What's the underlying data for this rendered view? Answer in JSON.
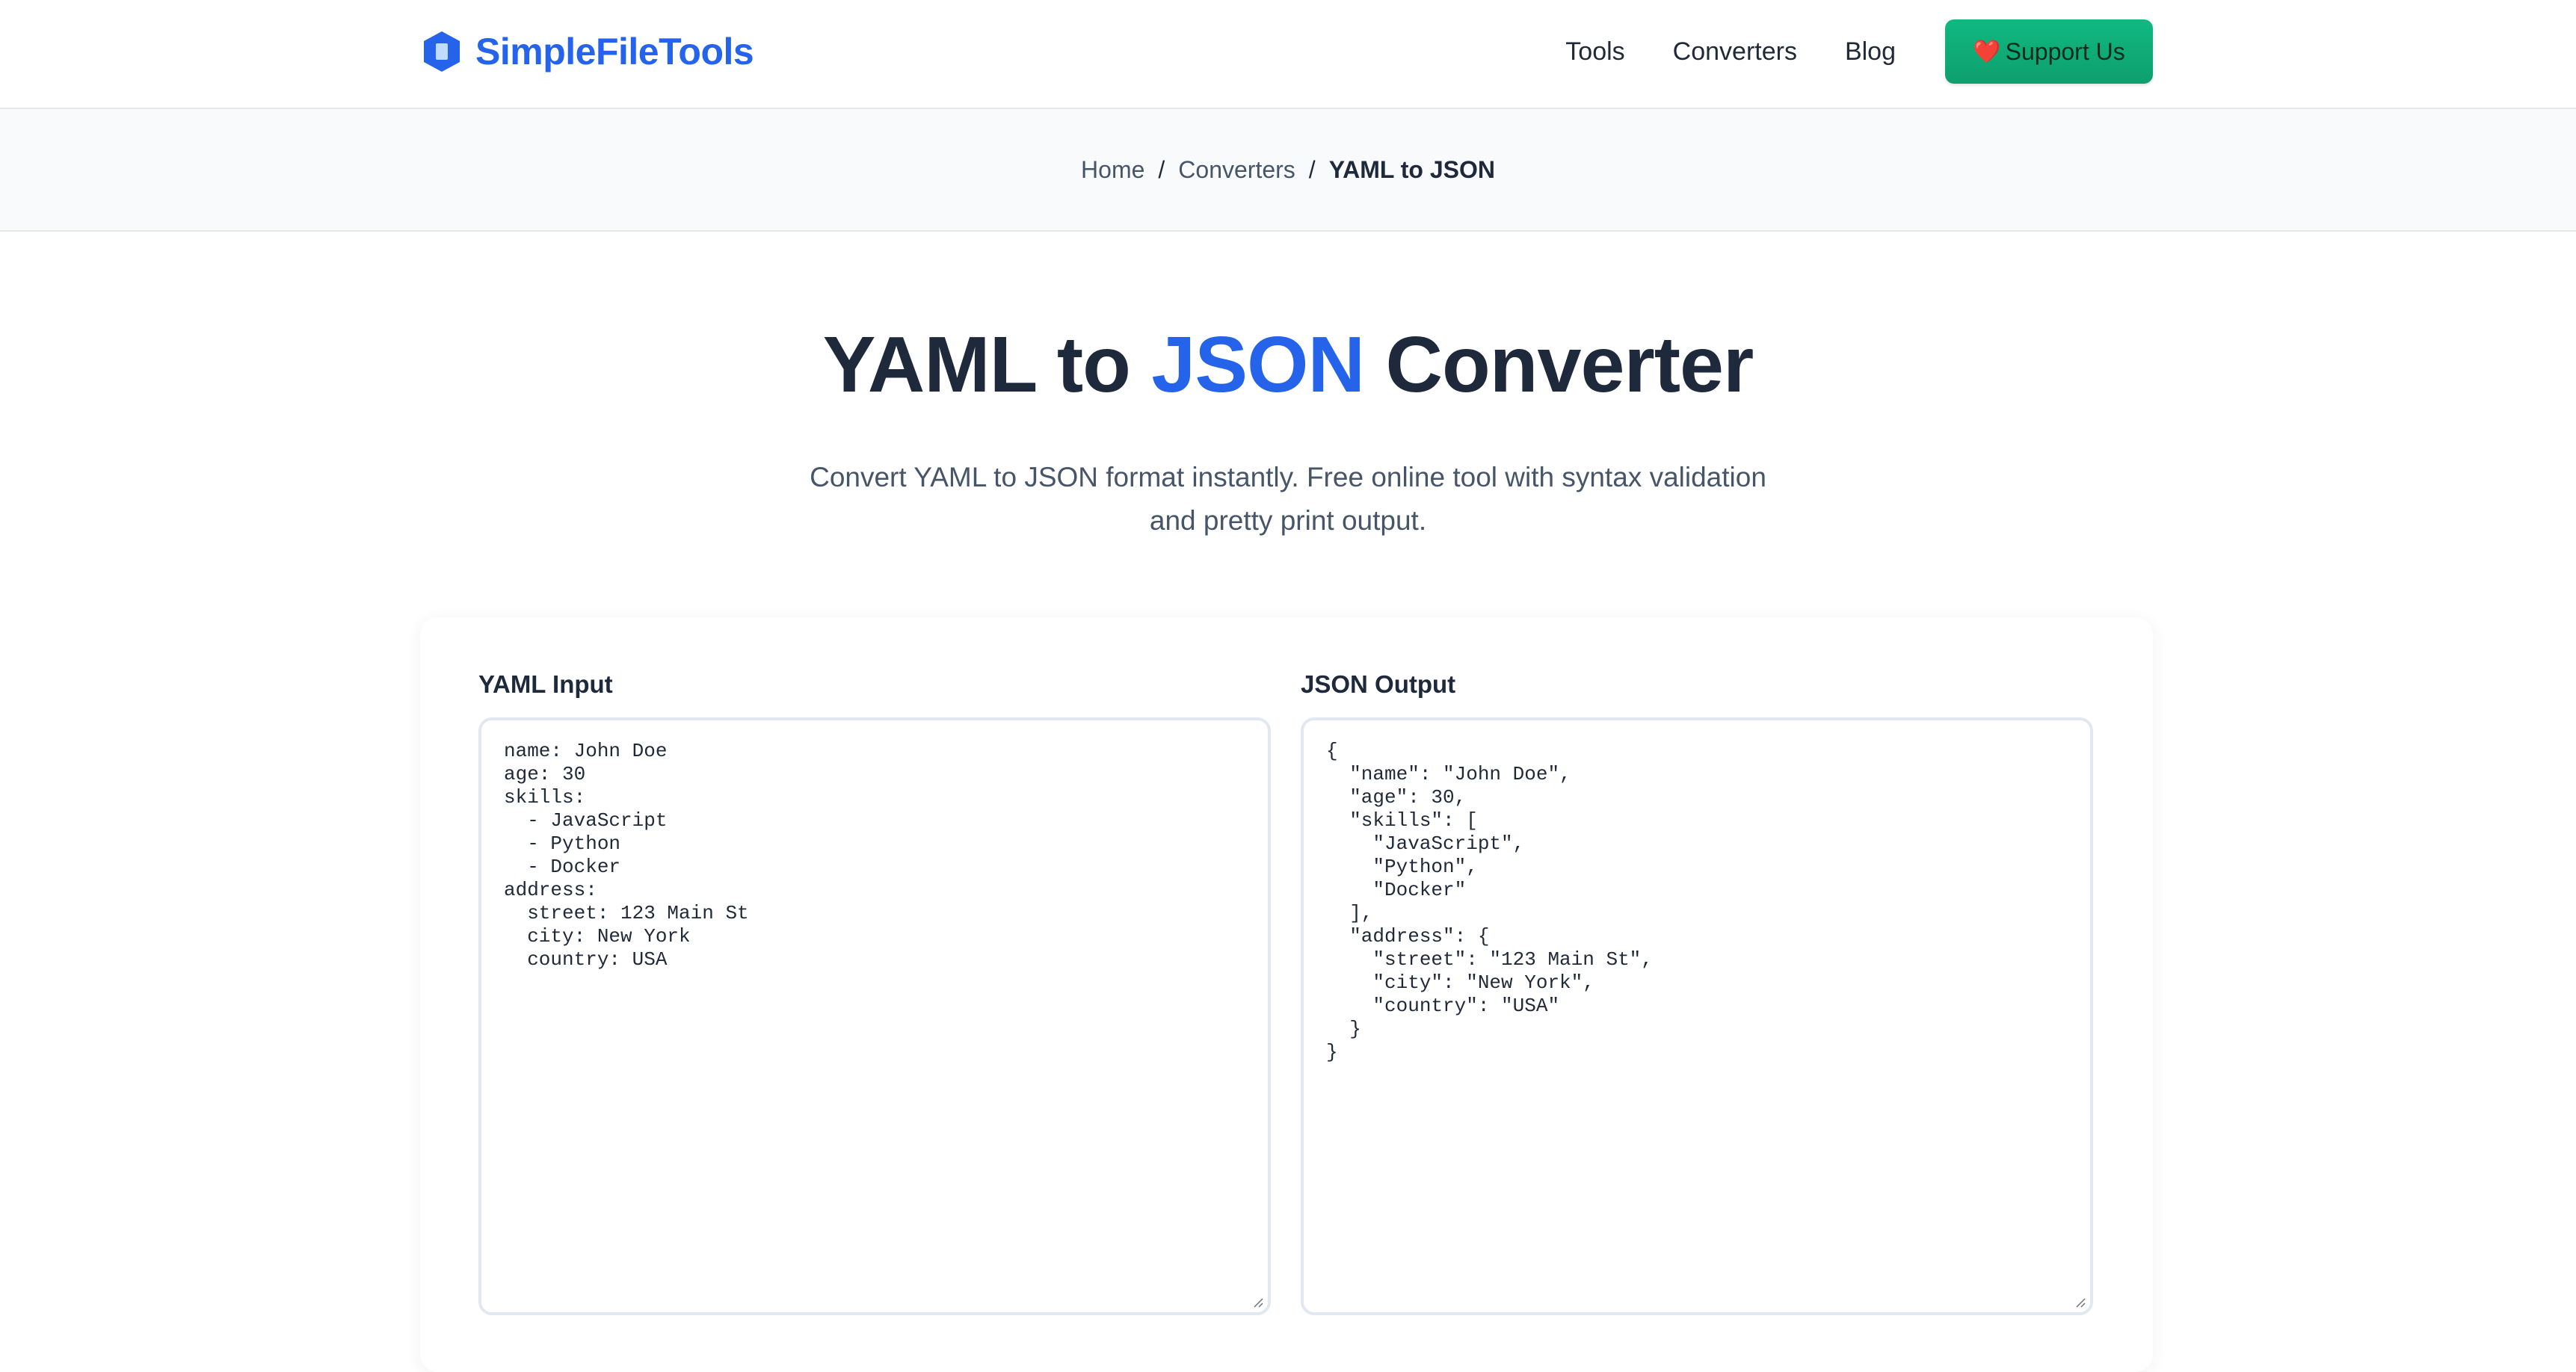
{
  "header": {
    "logo_text": "SimpleFileTools",
    "logo_icon": "hexagon-file-icon",
    "nav": [
      {
        "label": "Tools"
      },
      {
        "label": "Converters"
      },
      {
        "label": "Blog"
      }
    ],
    "support_label": "Support Us",
    "support_icon": "heart-icon",
    "brand_color": "#2563eb",
    "support_color": "#10b981"
  },
  "breadcrumb": {
    "home": "Home",
    "section": "Converters",
    "current": "YAML to JSON",
    "separator": "/"
  },
  "hero": {
    "title_part1": "YAML to ",
    "title_accent": "JSON",
    "title_part2": " Converter",
    "subtitle_line1": "Convert YAML to JSON format instantly. Free online tool with syntax validation",
    "subtitle_line2": "and pretty print output."
  },
  "converter": {
    "input_label": "YAML Input",
    "output_label": "JSON Output",
    "input_value": "name: John Doe\nage: 30\nskills:\n  - JavaScript\n  - Python\n  - Docker\naddress:\n  street: 123 Main St\n  city: New York\n  country: USA",
    "output_value": "{\n  \"name\": \"John Doe\",\n  \"age\": 30,\n  \"skills\": [\n    \"JavaScript\",\n    \"Python\",\n    \"Docker\"\n  ],\n  \"address\": {\n    \"street\": \"123 Main St\",\n    \"city\": \"New York\",\n    \"country\": \"USA\"\n  }\n}"
  }
}
